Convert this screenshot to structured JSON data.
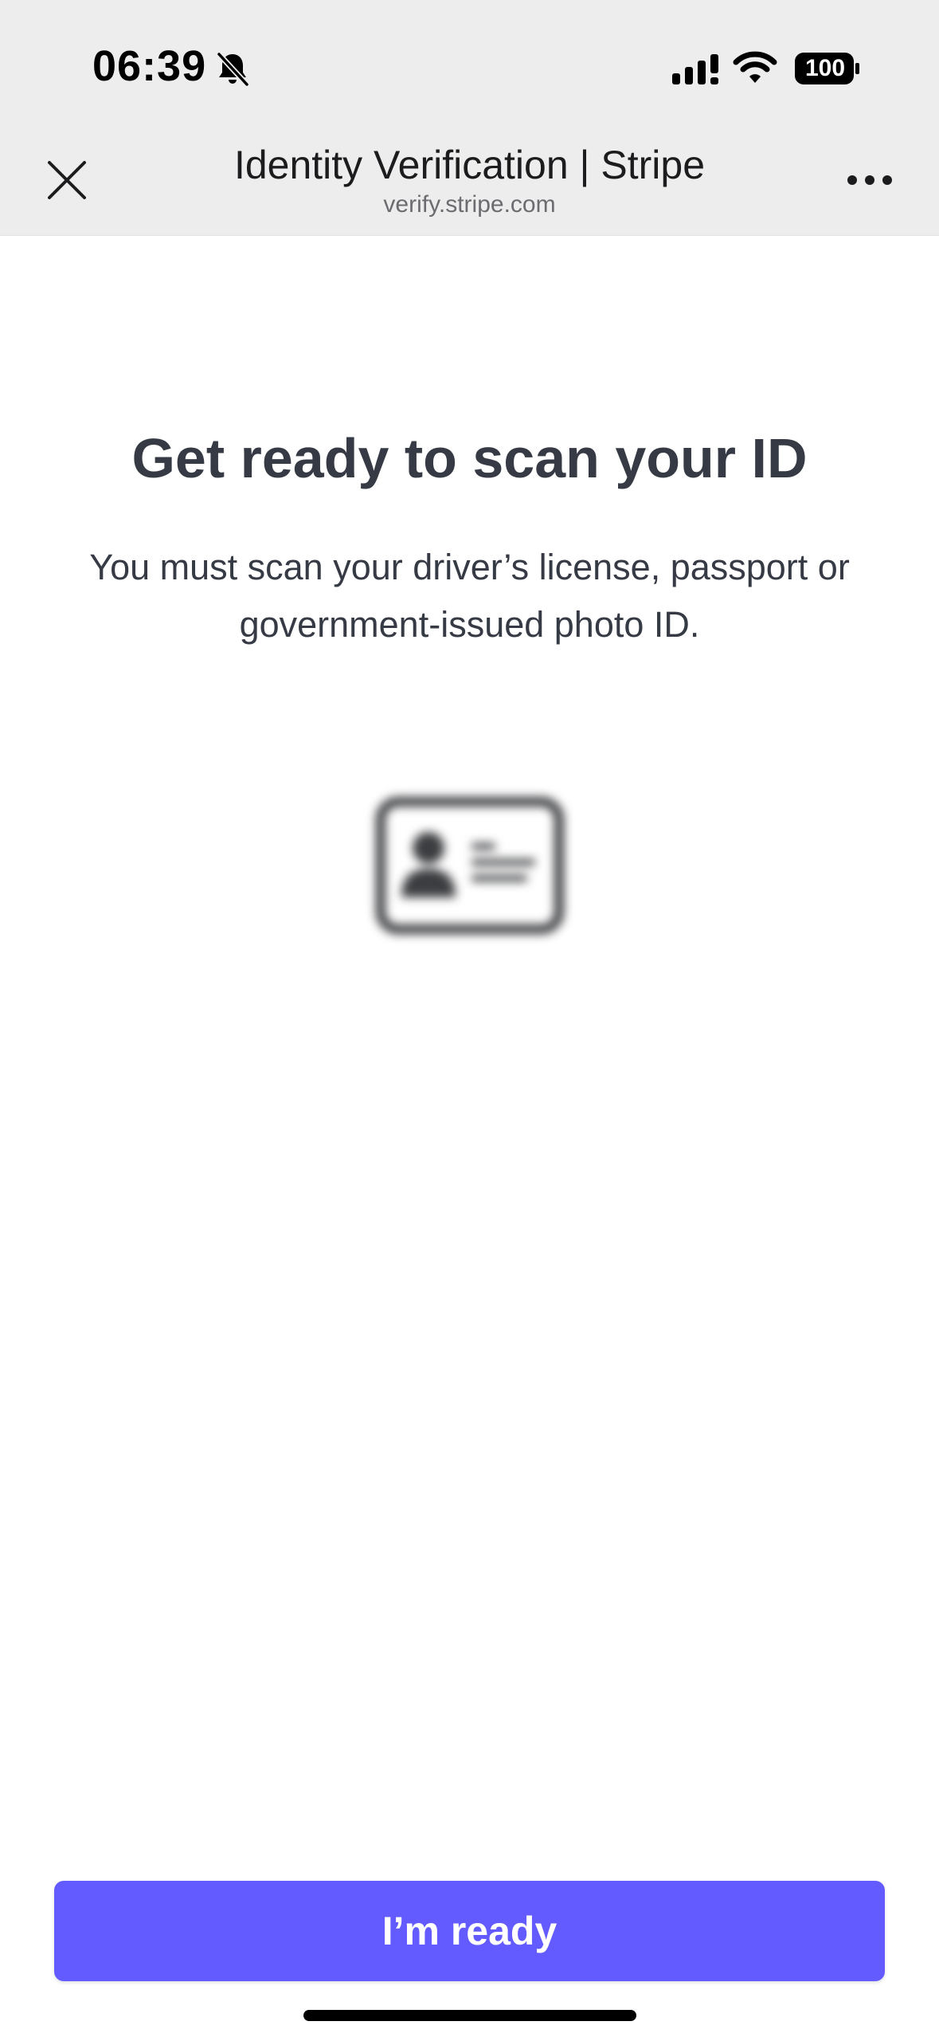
{
  "status_bar": {
    "time": "06:39",
    "battery": "100",
    "icons": [
      "bell-slash-icon",
      "signal-icon",
      "wifi-icon",
      "battery-icon"
    ]
  },
  "browser": {
    "title": "Identity Verification | Stripe",
    "url": "verify.stripe.com",
    "icons": [
      "close-icon",
      "more-icon"
    ]
  },
  "main": {
    "heading": "Get ready to scan your ID",
    "subtitle": "You must scan your driver’s license, passport or government-issued photo ID.",
    "illustration_icon": "id-card-icon",
    "ready_button_label": "I’m ready"
  },
  "colors": {
    "chrome_background": "#ededed",
    "accent": "#635bff",
    "heading_text": "#353a44",
    "button_text": "#ffffff"
  }
}
